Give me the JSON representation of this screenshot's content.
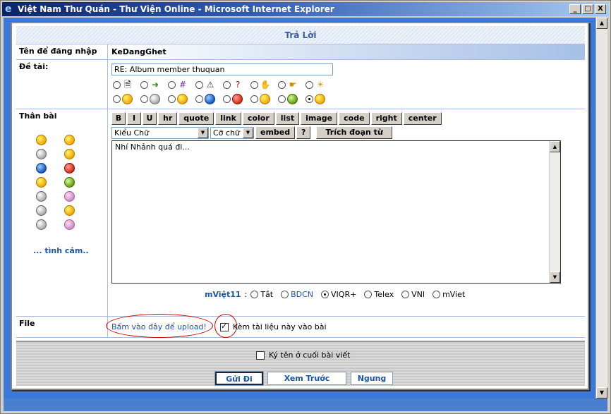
{
  "window": {
    "title": "Việt Nam Thư Quán - Thư Viện Online - Microsoft Internet Explorer",
    "min_glyph": "_",
    "max_glyph": "□",
    "close_glyph": "X"
  },
  "form": {
    "header": "Trả Lời",
    "username_label": "Tên để đăng nhập",
    "username_value": "KeDangGhet",
    "subject_label": "Đề tài:",
    "subject_value": "RE: Album member thuquan",
    "body_label": "Thân bài",
    "feelings_link": "... tình cảm..",
    "body_text": "Nhí Nhảnh quá đi...",
    "file_label": "File",
    "upload_link": "Bấm vào đây để upload!",
    "attach_label": "Kèm tài liệu này vào bài",
    "attach_checked": true
  },
  "toolbar": {
    "buttons": [
      "B",
      "I",
      "U",
      "hr",
      "quote",
      "link",
      "color",
      "list",
      "image",
      "code",
      "right",
      "center"
    ],
    "font_select": "Kiểu Chữ",
    "size_select": "Cỡ chữ",
    "embed": "embed",
    "help": "?",
    "quote_selection": "Trích đoạn từ"
  },
  "mviet": {
    "brand": "mViệt11",
    "colon": ":",
    "options": [
      "Tắt",
      "BDCN",
      "VIQR+",
      "Telex",
      "VNI",
      "mViet"
    ],
    "selected": "VIQR+"
  },
  "footer": {
    "sign_label": "Ký tên ở cuối bài viết",
    "sign_checked": false,
    "submit": "Gửi Đi",
    "preview": "Xem Trước",
    "cancel": "Ngưng"
  },
  "icons_selected_index": 15
}
